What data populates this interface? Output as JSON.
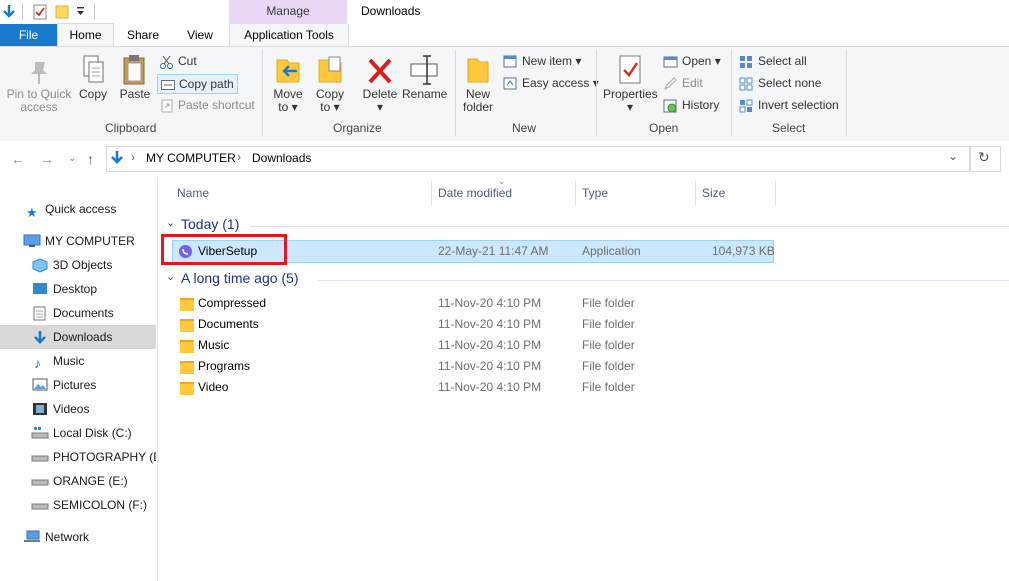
{
  "title_bar": {
    "contextual_tab_group": "Manage",
    "window_title": "Downloads"
  },
  "ribbon_tabs": {
    "file": "File",
    "home": "Home",
    "share": "Share",
    "view": "View",
    "application_tools": "Application Tools"
  },
  "ribbon": {
    "clipboard": {
      "label": "Clipboard",
      "pin_line1": "Pin to Quick",
      "pin_line2": "access",
      "copy": "Copy",
      "paste": "Paste",
      "cut": "Cut",
      "copy_path": "Copy path",
      "paste_shortcut": "Paste shortcut"
    },
    "organize": {
      "label": "Organize",
      "move_line1": "Move",
      "move_line2": "to",
      "copy_line1": "Copy",
      "copy_line2": "to",
      "delete": "Delete",
      "rename": "Rename"
    },
    "new": {
      "label": "New",
      "folder_line1": "New",
      "folder_line2": "folder",
      "new_item": "New item",
      "easy_access": "Easy access"
    },
    "open": {
      "label": "Open",
      "properties": "Properties",
      "open": "Open",
      "edit": "Edit",
      "history": "History"
    },
    "select": {
      "label": "Select",
      "select_all": "Select all",
      "select_none": "Select none",
      "invert": "Invert selection"
    }
  },
  "address_bar": {
    "path": [
      "MY COMPUTER",
      "Downloads"
    ]
  },
  "nav_pane": {
    "quick_access": "Quick access",
    "my_computer": "MY COMPUTER",
    "items": [
      "3D Objects",
      "Desktop",
      "Documents",
      "Downloads",
      "Music",
      "Pictures",
      "Videos",
      "Local Disk (C:)",
      "PHOTOGRAPHY (D:",
      "ORANGE (E:)",
      "SEMICOLON (F:)"
    ],
    "network": "Network"
  },
  "columns": {
    "name": "Name",
    "date": "Date modified",
    "type": "Type",
    "size": "Size"
  },
  "groups": {
    "today": {
      "header": "Today (1)",
      "files": [
        {
          "name": "ViberSetup",
          "date": "22-May-21 11:47 AM",
          "type": "Application",
          "size": "104,973 KB"
        }
      ]
    },
    "long_ago": {
      "header": "A long time ago (5)",
      "files": [
        {
          "name": "Compressed",
          "date": "11-Nov-20 4:10 PM",
          "type": "File folder"
        },
        {
          "name": "Documents",
          "date": "11-Nov-20 4:10 PM",
          "type": "File folder"
        },
        {
          "name": "Music",
          "date": "11-Nov-20 4:10 PM",
          "type": "File folder"
        },
        {
          "name": "Programs",
          "date": "11-Nov-20 4:10 PM",
          "type": "File folder"
        },
        {
          "name": "Video",
          "date": "11-Nov-20 4:10 PM",
          "type": "File folder"
        }
      ]
    }
  },
  "colors": {
    "accent": "#1979ca",
    "selection": "#cce8ff",
    "annotation": "#e8161c",
    "group_header": "#1e3287"
  }
}
